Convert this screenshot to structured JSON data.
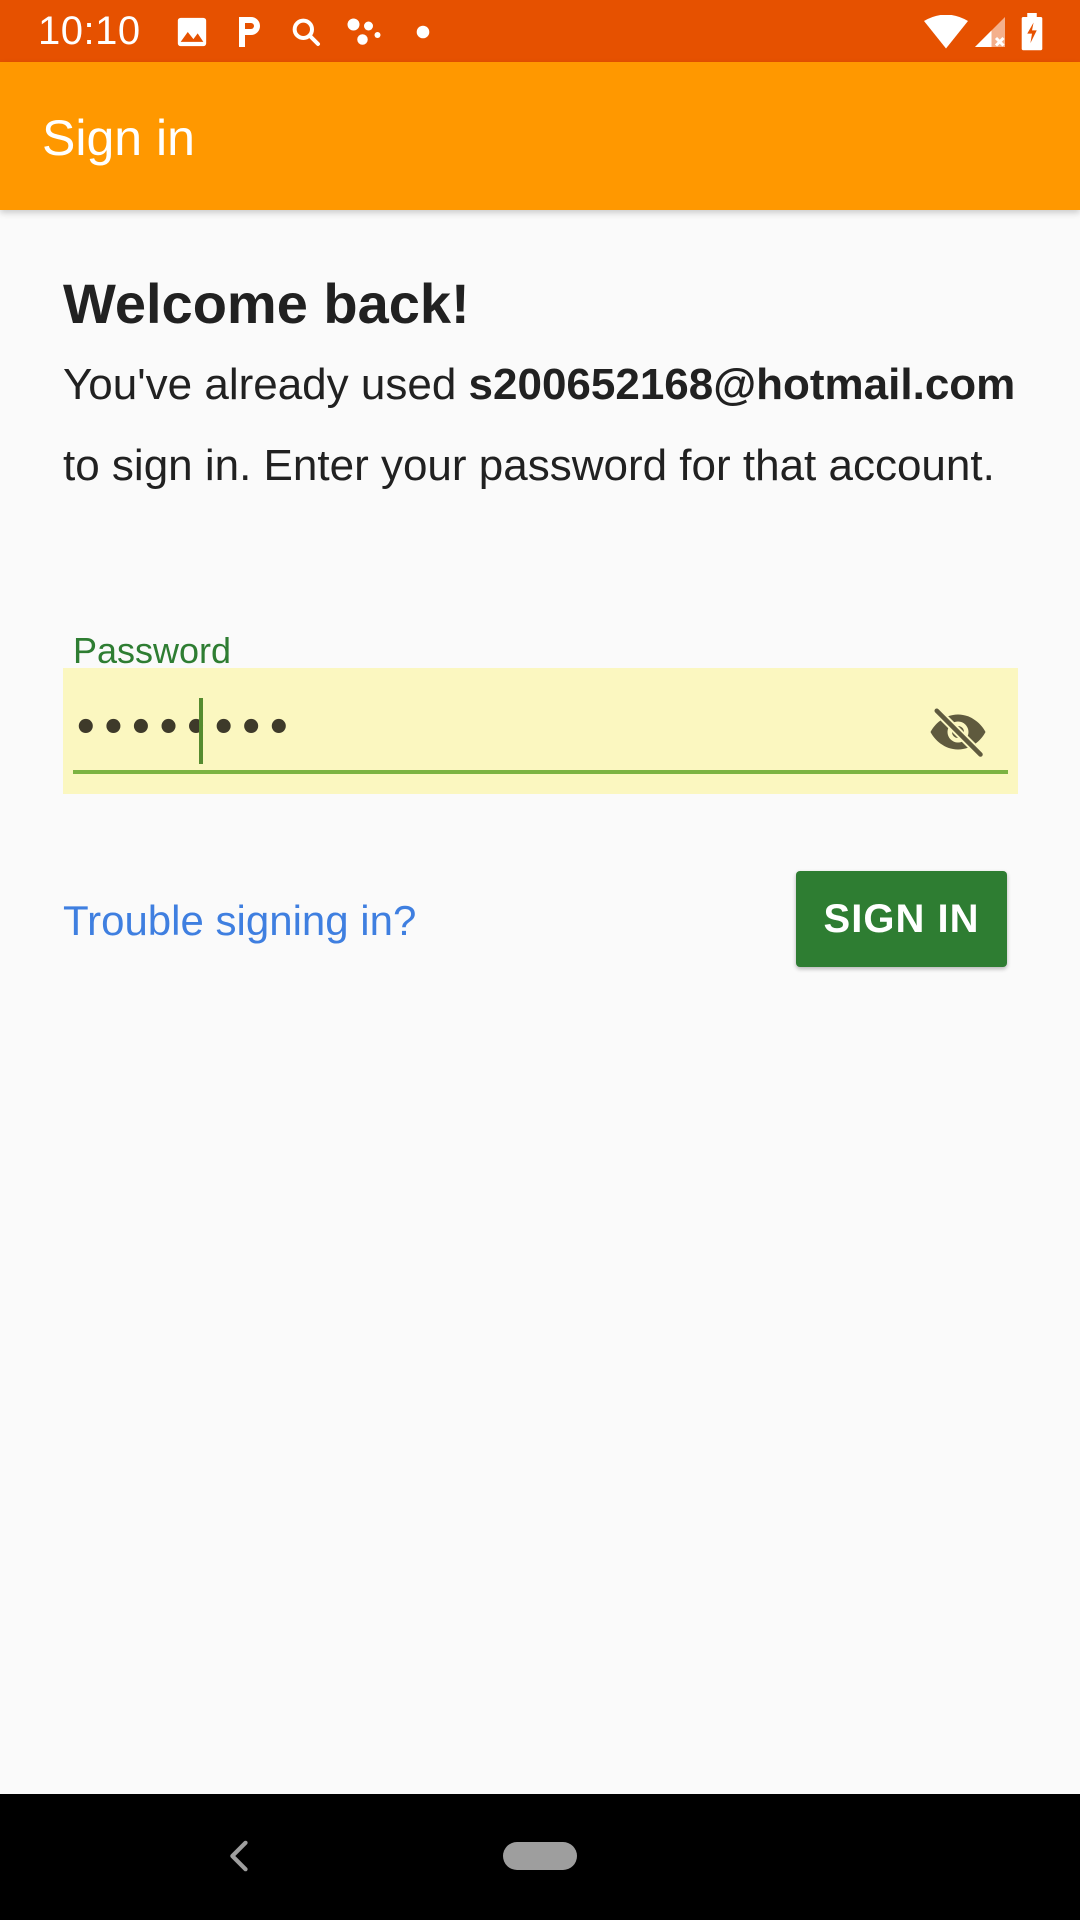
{
  "status_bar": {
    "time": "10:10",
    "background": "#E65100",
    "icons_left": [
      "image-icon",
      "p-icon",
      "search-icon",
      "dots-icon",
      "dot-icon"
    ],
    "icons_right": [
      "wifi-icon",
      "signal-icon",
      "battery-icon"
    ]
  },
  "app_bar": {
    "title": "Sign in",
    "background": "#FF9800"
  },
  "welcome": {
    "title": "Welcome back!",
    "text_before": "You've already used ",
    "email": "s200652168@hotmail.com",
    "text_after": " to sign in. Enter your password for that account."
  },
  "password": {
    "label": "Password",
    "value": "••••••••",
    "toggle_icon": "visibility-off-icon"
  },
  "actions": {
    "trouble_link": "Trouble signing in?",
    "sign_in_label": "SIGN IN",
    "sign_in_color": "#2E7D32"
  },
  "nav_bar": {
    "back_icon": "back-icon",
    "home_icon": "home-pill-icon"
  }
}
